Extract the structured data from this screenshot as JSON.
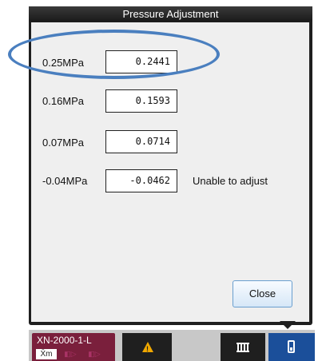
{
  "dialog": {
    "title": "Pressure Adjustment",
    "close_label": "Close"
  },
  "rows": [
    {
      "label": "0.25MPa",
      "value": "0.2441",
      "note": ""
    },
    {
      "label": "0.16MPa",
      "value": "0.1593",
      "note": ""
    },
    {
      "label": "0.07MPa",
      "value": "0.0714",
      "note": ""
    },
    {
      "label": "-0.04MPa",
      "value": "-0.0462",
      "note": "Unable to adjust"
    }
  ],
  "taskbar": {
    "device_name": "XN-2000-1-L",
    "device_mode": "X̄m",
    "icons": [
      "warning-icon",
      "rack-icon",
      "sample-tube-icon"
    ]
  },
  "colors": {
    "highlight_ring": "#4a7fbf",
    "device_tab": "#7a1f3c",
    "active_tab": "#1b4f9a",
    "warning": "#f0a800"
  }
}
